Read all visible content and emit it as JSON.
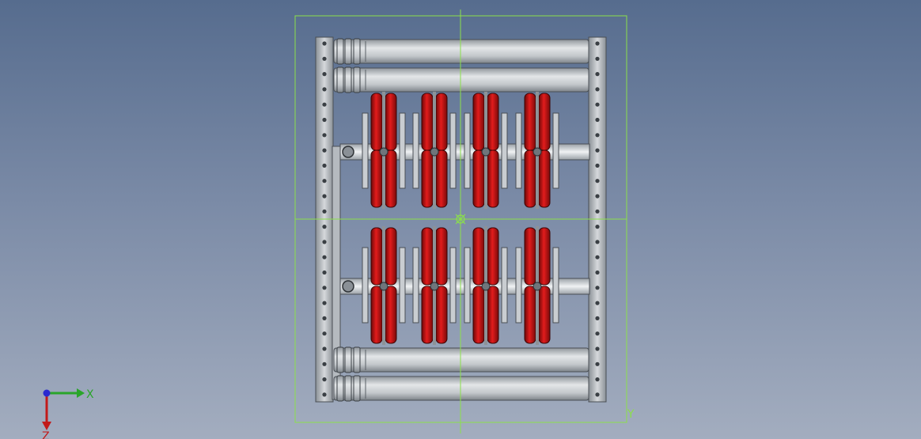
{
  "viewport": {
    "background_top": "#566c8e",
    "background_bottom": "#a3adbf",
    "selection_color": "#8be04a",
    "roller_color": "#c8cccf",
    "wheel_color": "#d01818",
    "frame_color": "#b9bec3"
  },
  "model": {
    "top_roller_count": 2,
    "bottom_roller_count": 2,
    "wheel_bank_columns": 4,
    "wheel_bank_rows": 4
  },
  "triad": {
    "x_label": "X",
    "z_label": "Z",
    "x_color": "#2aa52a",
    "z_color": "#c21a1a",
    "origin_color": "#2a2ad0"
  },
  "bbox_corner_label": "Y"
}
